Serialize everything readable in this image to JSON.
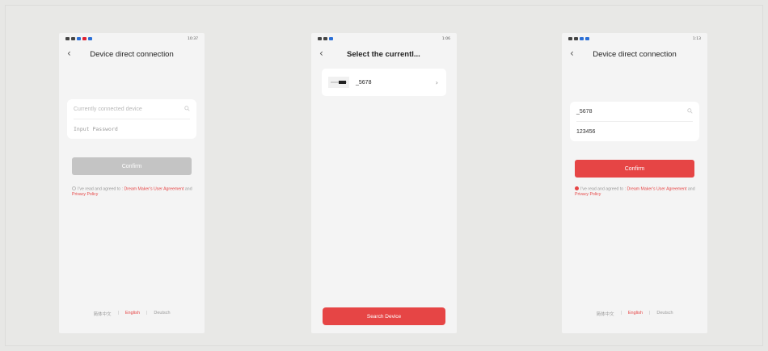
{
  "screens": [
    {
      "status_time": "10:37",
      "title": "Device direct connection",
      "device_placeholder": "Currently connected device",
      "password_placeholder": "Input Password",
      "confirm_label": "Confirm",
      "agree_prefix": "I've read and agreed to :",
      "agree_link1": "Dream Maker's User Agreement",
      "agree_and": "and",
      "agree_link2": "Privacy Policy",
      "lang_zh": "简体中文",
      "lang_en": "English",
      "lang_de": "Deutsch",
      "sep": "|"
    },
    {
      "status_time": "1:06",
      "title": "Select the currentl...",
      "device_name": "_5678",
      "search_label": "Search Device"
    },
    {
      "status_time": "1:13",
      "title": "Device direct connection",
      "device_value": "_5678",
      "password_value": "123456",
      "confirm_label": "Confirm",
      "agree_prefix": "I've read and agreed to :",
      "agree_link1": "Dream Maker's User Agreement",
      "agree_and": "and",
      "agree_link2": "Privacy Policy",
      "lang_zh": "简体中文",
      "lang_en": "English",
      "lang_de": "Deutsch",
      "sep": "|"
    }
  ],
  "icons": {
    "back": "back-arrow-icon",
    "search": "search-icon",
    "chevron": "chevron-right-icon"
  },
  "colors": {
    "accent": "#e64545",
    "disabled": "#c4c4c4",
    "background": "#e8e8e6"
  }
}
